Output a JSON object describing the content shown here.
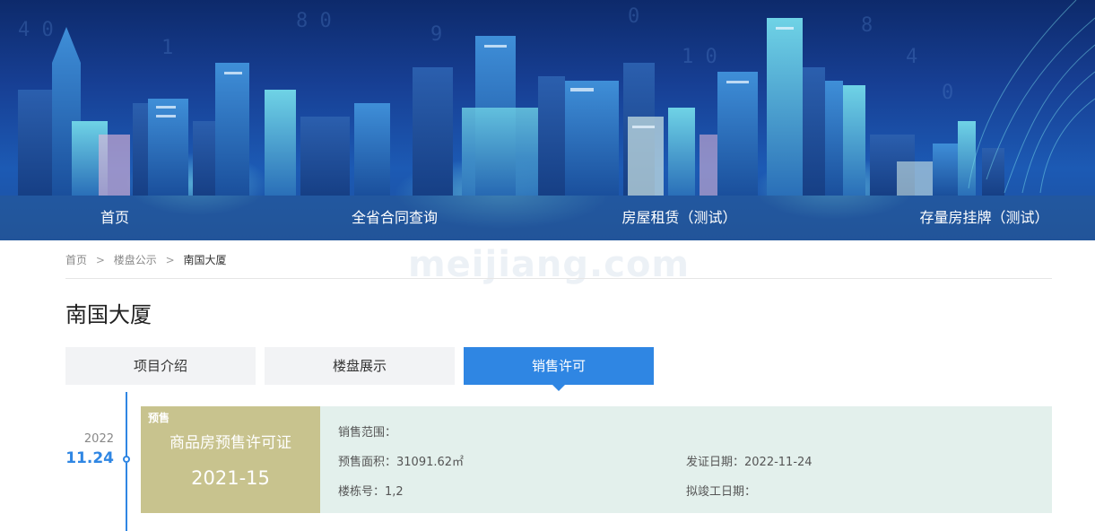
{
  "nav": {
    "items": [
      {
        "label": "首页"
      },
      {
        "label": "全省合同查询"
      },
      {
        "label": "房屋租赁（测试）"
      },
      {
        "label": "存量房挂牌（测试）"
      }
    ]
  },
  "watermark": "meijiang.com",
  "breadcrumb": {
    "home": "首页",
    "listing": "楼盘公示",
    "current": "南国大厦",
    "separator": ">"
  },
  "page": {
    "title": "南国大厦"
  },
  "tabs": [
    {
      "label": "项目介绍",
      "active": false
    },
    {
      "label": "楼盘展示",
      "active": false
    },
    {
      "label": "销售许可",
      "active": true
    }
  ],
  "timeline": {
    "year": "2022",
    "date": "11.24"
  },
  "permit": {
    "badge": "预售",
    "type": "商品房预售许可证",
    "number": "2021-15",
    "sales_scope": {
      "label": "销售范围：",
      "value": ""
    },
    "presale_area": {
      "label": "预售面积：",
      "value": "31091.62㎡"
    },
    "issue_date": {
      "label": "发证日期：",
      "value": "2022-11-24"
    },
    "building_no": {
      "label": "楼栋号：",
      "value": "1,2"
    },
    "completion_date": {
      "label": "拟竣工日期：",
      "value": ""
    }
  },
  "colors": {
    "accent": "#2f86e3",
    "card_left": "#c8c38e",
    "card_right": "#e3f0ec"
  }
}
